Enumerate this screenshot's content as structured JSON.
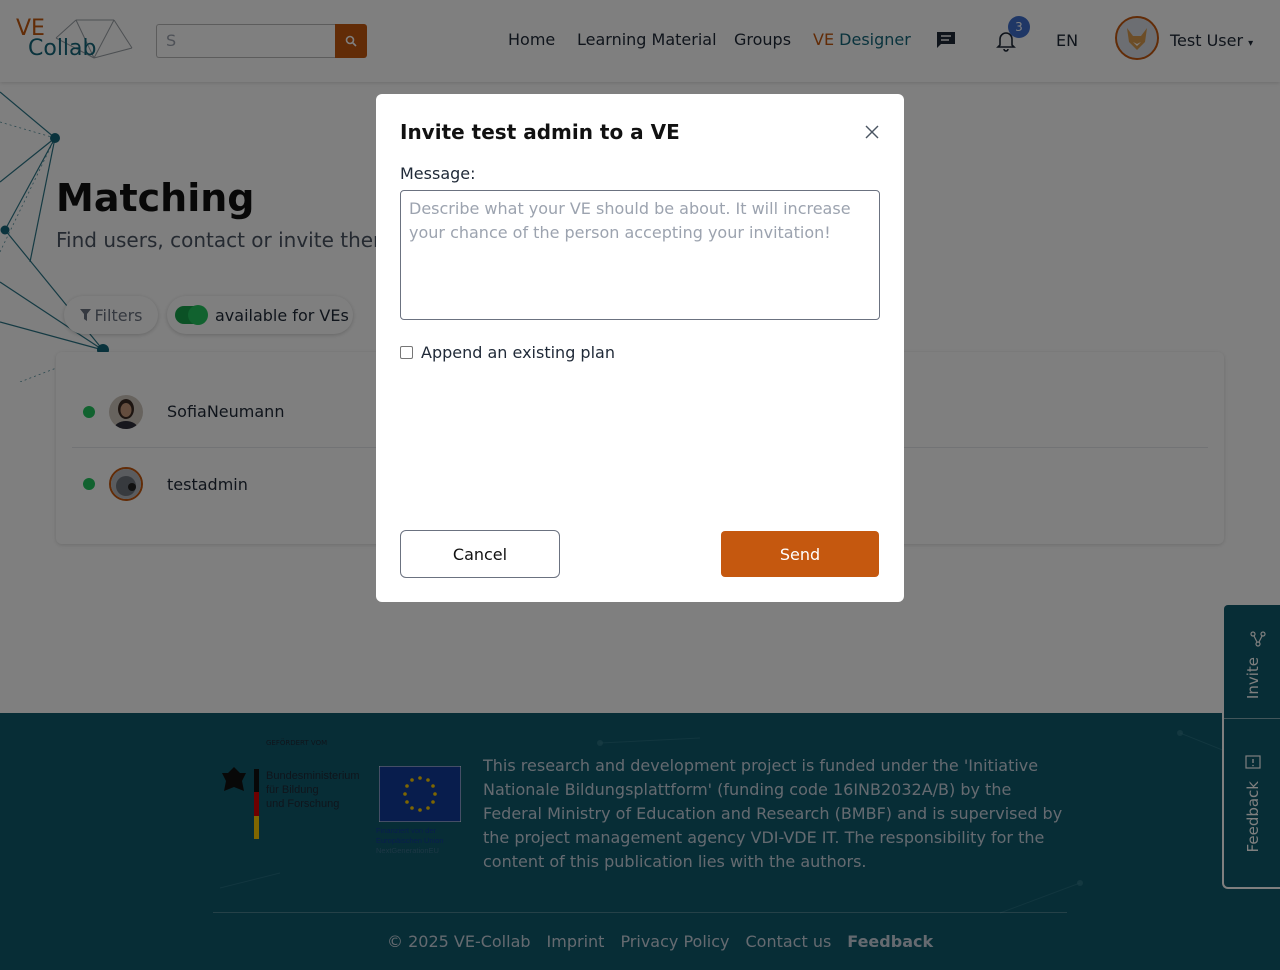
{
  "header": {
    "logo_ve": "VE",
    "logo_collab": "Collab",
    "search_value": "S",
    "nav": {
      "home": "Home",
      "learning_material": "Learning Material",
      "groups": "Groups",
      "ve_designer_prefix": "VE",
      "ve_designer_suffix": "Designer"
    },
    "notification_count": "3",
    "language": "EN",
    "user_name": "Test User"
  },
  "matching": {
    "title": "Matching",
    "subtitle": "Find users, contact or invite them",
    "filters_label": "Filters",
    "available_label": "available for VEs",
    "users": [
      {
        "name": "SofiaNeumann",
        "status": "online"
      },
      {
        "name": "testadmin",
        "status": "online"
      }
    ]
  },
  "modal": {
    "title": "Invite test admin to a VE",
    "message_label": "Message:",
    "message_placeholder": "Describe what your VE should be about. It will increase your chance of the person accepting your invitation!",
    "message_value": "",
    "append_label": "Append an existing plan",
    "append_checked": false,
    "cancel_label": "Cancel",
    "send_label": "Send"
  },
  "footer": {
    "bmbf_small": "GEFÖRDERT VOM",
    "bmbf_line1": "Bundesministerium",
    "bmbf_line2": "für Bildung",
    "bmbf_line3": "und Forschung",
    "eu_line1": "Finanziert von der",
    "eu_line2": "Europäischen Union",
    "eu_line3": "NextGenerationEU",
    "funding_text": "This research and development project is funded under the 'Initiative Nationale Bildungsplattform' (funding code 16INB2032A/B) by the Federal Ministry of Education and Research (BMBF) and is supervised by the project management agency VDI-VDE IT. The responsibility for the content of this publication lies with the authors.",
    "copyright": "© 2025 VE-Collab",
    "links": {
      "imprint": "Imprint",
      "privacy": "Privacy Policy",
      "contact": "Contact us",
      "feedback": "Feedback"
    }
  },
  "side_tabs": {
    "invite": "Invite",
    "feedback": "Feedback"
  },
  "colors": {
    "brand_orange": "#c5580f",
    "brand_teal": "#14677b",
    "footer_bg": "#0e5a6c",
    "online_green": "#22c55e",
    "badge_blue": "#3f6ecd"
  }
}
